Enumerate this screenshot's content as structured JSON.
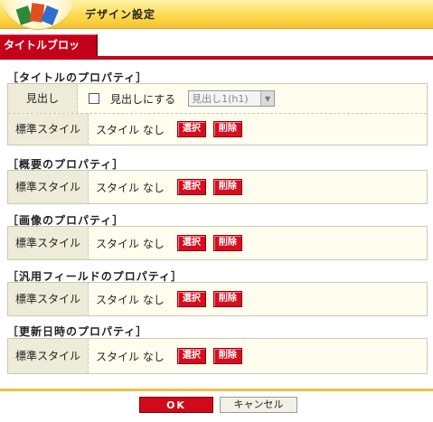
{
  "header": {
    "title": "デザイン設定"
  },
  "tab": {
    "label": "タイトルブロック"
  },
  "sections": [
    {
      "title": "［タイトルのプロパティ］",
      "heading_row": {
        "label": "見出し",
        "checkbox_label": "見出しにする",
        "select_value": "見出し1(h1)"
      },
      "style_row": {
        "label": "標準スタイル",
        "value": "スタイル なし",
        "select_btn": "選択",
        "delete_btn": "削除"
      }
    },
    {
      "title": "［概要のプロパティ］",
      "style_row": {
        "label": "標準スタイル",
        "value": "スタイル なし",
        "select_btn": "選択",
        "delete_btn": "削除"
      }
    },
    {
      "title": "［画像のプロパティ］",
      "style_row": {
        "label": "標準スタイル",
        "value": "スタイル なし",
        "select_btn": "選択",
        "delete_btn": "削除"
      }
    },
    {
      "title": "［汎用フィールドのプロパティ］",
      "style_row": {
        "label": "標準スタイル",
        "value": "スタイル なし",
        "select_btn": "選択",
        "delete_btn": "削除"
      }
    },
    {
      "title": "［更新日時のプロパティ］",
      "style_row": {
        "label": "標準スタイル",
        "value": "スタイル なし",
        "select_btn": "選択",
        "delete_btn": "削除"
      }
    }
  ],
  "footer": {
    "ok_label": "OK",
    "cancel_label": "キャンセル"
  },
  "colors": {
    "accent_red": "#c4001a",
    "header_yellow": "#ffd84a",
    "panel_bg": "#fffdee",
    "label_bg": "#eeecd8"
  }
}
